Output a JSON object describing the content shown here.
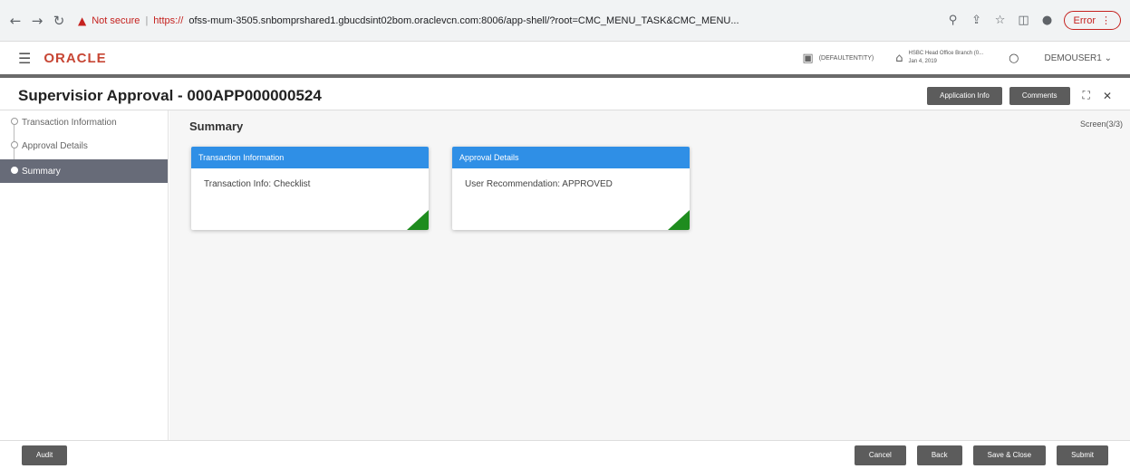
{
  "browser": {
    "security_label": "Not secure",
    "separator": "|",
    "url_scheme": "https://",
    "url_rest": "ofss-mum-3505.snbomprshared1.gbucdsint02bom.oraclevcn.com:8006/app-shell/?root=CMC_MENU_TASK&CMC_MENU...",
    "error_label": "Error"
  },
  "header": {
    "logo": "ORACLE",
    "entity": "(DEFAULTENTITY)",
    "branch_line1": "HSBC Head Office Branch (0...",
    "branch_line2": "Jan 4, 2019",
    "user": "DEMOUSER1"
  },
  "title_bar": {
    "title": "Supervisior Approval - 000APP000000524",
    "application_info": "Application Info",
    "comments": "Comments"
  },
  "sidebar": {
    "steps": [
      {
        "label": "Transaction Information"
      },
      {
        "label": "Approval Details"
      },
      {
        "label": "Summary"
      }
    ]
  },
  "main": {
    "title": "Summary",
    "screen_count": "Screen(3/3)",
    "cards": [
      {
        "header": "Transaction Information",
        "body": "Transaction Info: Checklist"
      },
      {
        "header": "Approval Details",
        "body": "User Recommendation: APPROVED"
      }
    ],
    "card_corner_color": "#1e8c1e",
    "card_header_color": "#2f8fe6"
  },
  "footer": {
    "audit": "Audit",
    "cancel": "Cancel",
    "back": "Back",
    "save_close": "Save & Close",
    "submit": "Submit"
  }
}
